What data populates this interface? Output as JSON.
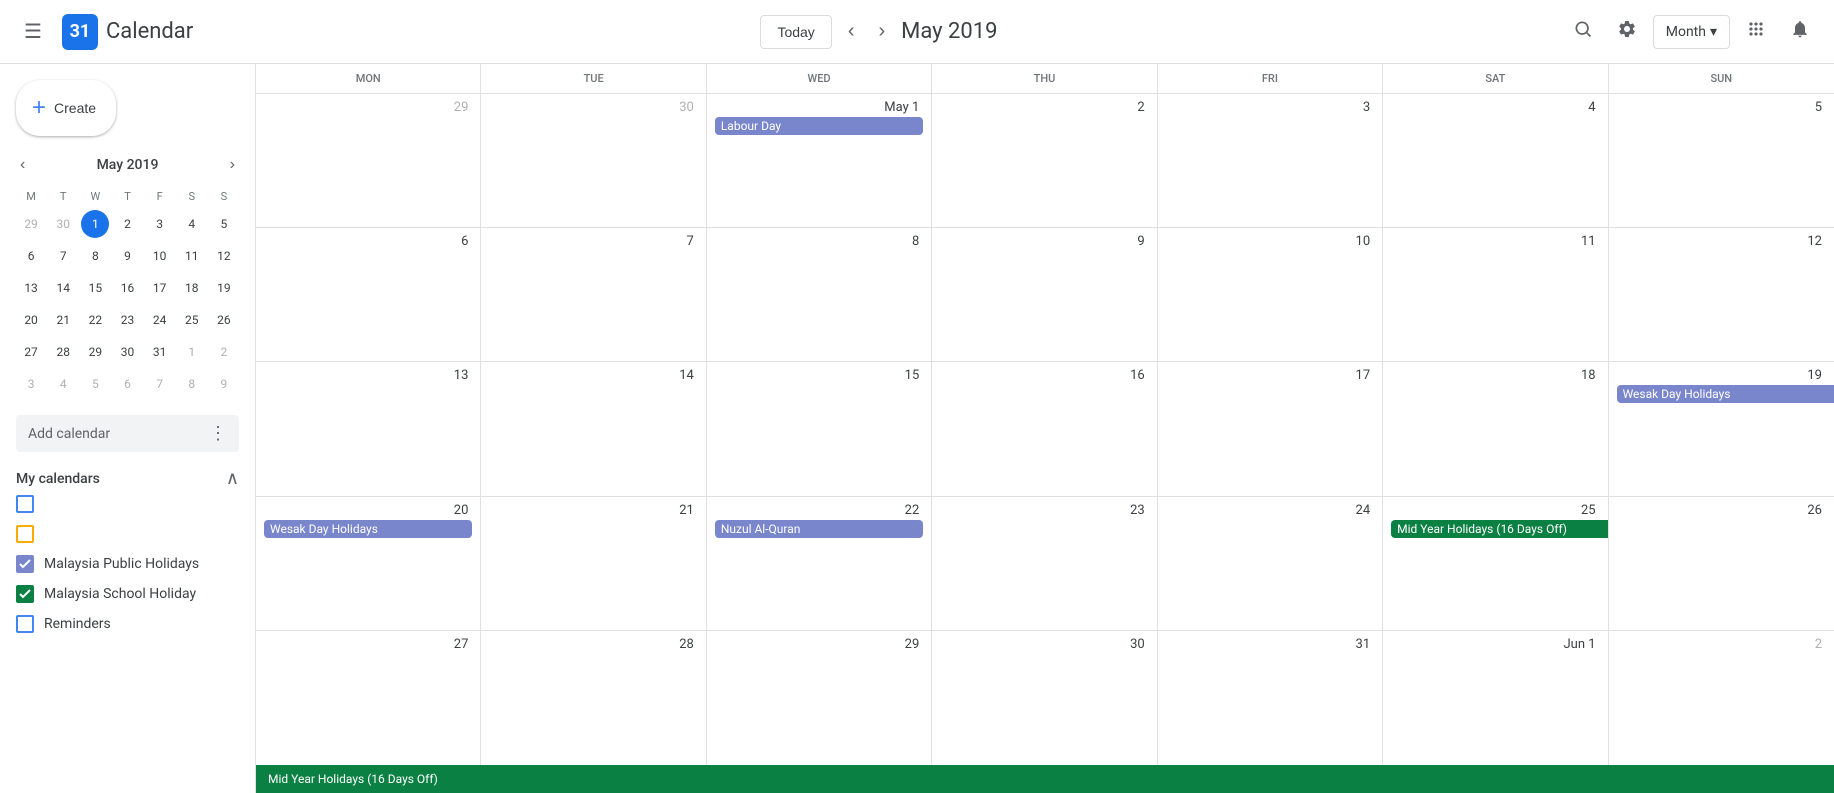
{
  "topNav": {
    "hamburger": "☰",
    "logoText": "31",
    "appTitle": "Calendar",
    "todayLabel": "Today",
    "prevArrow": "‹",
    "nextArrow": "›",
    "monthYear": "May 2019",
    "viewLabel": "Month",
    "viewDropArrow": "▾"
  },
  "sidebar": {
    "createLabel": "Create",
    "miniCal": {
      "title": "May 2019",
      "daysOfWeek": [
        "M",
        "T",
        "W",
        "T",
        "F",
        "S",
        "S"
      ],
      "weeks": [
        [
          {
            "day": 29,
            "otherMonth": true
          },
          {
            "day": 30,
            "otherMonth": true
          },
          {
            "day": 1,
            "today": true
          },
          {
            "day": 2
          },
          {
            "day": 3
          },
          {
            "day": 4
          },
          {
            "day": 5
          }
        ],
        [
          {
            "day": 6
          },
          {
            "day": 7
          },
          {
            "day": 8
          },
          {
            "day": 9
          },
          {
            "day": 10
          },
          {
            "day": 11
          },
          {
            "day": 12
          }
        ],
        [
          {
            "day": 13
          },
          {
            "day": 14
          },
          {
            "day": 15
          },
          {
            "day": 16
          },
          {
            "day": 17
          },
          {
            "day": 18
          },
          {
            "day": 19
          }
        ],
        [
          {
            "day": 20
          },
          {
            "day": 21
          },
          {
            "day": 22
          },
          {
            "day": 23
          },
          {
            "day": 24
          },
          {
            "day": 25
          },
          {
            "day": 26
          }
        ],
        [
          {
            "day": 27
          },
          {
            "day": 28
          },
          {
            "day": 29
          },
          {
            "day": 30
          },
          {
            "day": 31
          },
          {
            "day": 1,
            "otherMonth": true
          },
          {
            "day": 2,
            "otherMonth": true
          }
        ],
        [
          {
            "day": 3,
            "otherMonth": true
          },
          {
            "day": 4,
            "otherMonth": true
          },
          {
            "day": 5,
            "otherMonth": true
          },
          {
            "day": 6,
            "otherMonth": true
          },
          {
            "day": 7,
            "otherMonth": true
          },
          {
            "day": 8,
            "otherMonth": true
          },
          {
            "day": 9,
            "otherMonth": true
          }
        ]
      ]
    },
    "addCalendar": {
      "label": "Add calendar",
      "moreIcon": "⋮"
    },
    "myCalendarsSection": {
      "title": "My calendars",
      "collapseIcon": "∧"
    },
    "calendars": [
      {
        "id": "cal1",
        "color": "#4285f4",
        "colorBorder": "#4285f4",
        "checked": false,
        "label": ""
      },
      {
        "id": "cal2",
        "color": "#f9ab00",
        "colorBorder": "#f9ab00",
        "checked": false,
        "label": ""
      },
      {
        "id": "malaysia-holidays",
        "color": "#7986cb",
        "colorBorder": "#7986cb",
        "checked": true,
        "label": "Malaysia Public Holidays"
      },
      {
        "id": "malaysia-school",
        "color": "#0b8043",
        "colorBorder": "#0b8043",
        "checked": true,
        "label": "Malaysia School Holiday"
      },
      {
        "id": "reminders",
        "color": "#4285f4",
        "colorBorder": "#4285f4",
        "checked": false,
        "label": "Reminders"
      }
    ]
  },
  "grid": {
    "dayHeaders": [
      "MON",
      "TUE",
      "WED",
      "THU",
      "FRI",
      "SAT",
      "SUN"
    ],
    "weeks": [
      {
        "cells": [
          {
            "date": "29",
            "otherMonth": true,
            "events": []
          },
          {
            "date": "30",
            "otherMonth": true,
            "events": []
          },
          {
            "date": "May 1",
            "isFirst": true,
            "today": false,
            "events": [
              {
                "label": "Labour Day",
                "color": "purple"
              }
            ]
          },
          {
            "date": "2",
            "events": []
          },
          {
            "date": "3",
            "events": []
          },
          {
            "date": "4",
            "events": []
          },
          {
            "date": "5",
            "events": []
          }
        ]
      },
      {
        "cells": [
          {
            "date": "6",
            "events": []
          },
          {
            "date": "7",
            "events": []
          },
          {
            "date": "8",
            "events": []
          },
          {
            "date": "9",
            "events": []
          },
          {
            "date": "10",
            "events": []
          },
          {
            "date": "11",
            "events": []
          },
          {
            "date": "12",
            "events": []
          }
        ]
      },
      {
        "cells": [
          {
            "date": "13",
            "events": []
          },
          {
            "date": "14",
            "events": []
          },
          {
            "date": "15",
            "events": []
          },
          {
            "date": "16",
            "events": []
          },
          {
            "date": "17",
            "events": []
          },
          {
            "date": "18",
            "events": []
          },
          {
            "date": "19",
            "events": [
              {
                "label": "Wesak Day Holidays",
                "color": "purple",
                "spanRight": true
              }
            ]
          }
        ]
      },
      {
        "cells": [
          {
            "date": "20",
            "events": [
              {
                "label": "Wesak Day Holidays",
                "color": "purple"
              }
            ]
          },
          {
            "date": "21",
            "events": []
          },
          {
            "date": "22",
            "events": [
              {
                "label": "Nuzul Al-Quran",
                "color": "purple"
              }
            ]
          },
          {
            "date": "23",
            "events": []
          },
          {
            "date": "24",
            "events": []
          },
          {
            "date": "25",
            "events": [
              {
                "label": "Mid Year Holidays (16 Days Off)",
                "color": "green",
                "spanRight": true
              }
            ]
          },
          {
            "date": "26",
            "events": []
          }
        ]
      },
      {
        "cells": [
          {
            "date": "27",
            "events": []
          },
          {
            "date": "28",
            "events": []
          },
          {
            "date": "29",
            "events": []
          },
          {
            "date": "30",
            "events": []
          },
          {
            "date": "31",
            "events": []
          },
          {
            "date": "Jun 1",
            "isFirst": true,
            "events": []
          },
          {
            "date": "2",
            "otherMonth": true,
            "events": []
          }
        ]
      }
    ],
    "bottomBanner": {
      "label": "Mid Year Holidays (16 Days Off)",
      "color": "green"
    }
  }
}
